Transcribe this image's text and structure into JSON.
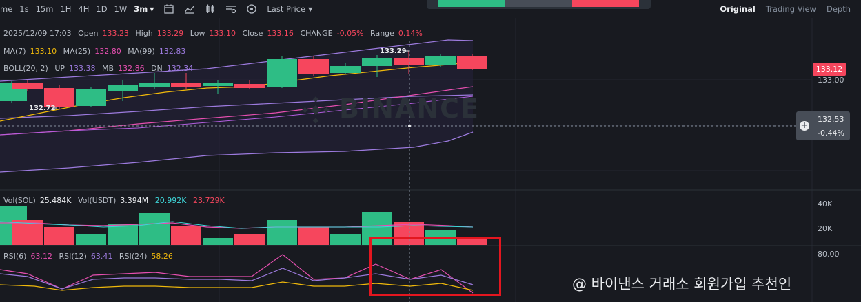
{
  "toolbar": {
    "intervals": [
      "me",
      "1s",
      "15m",
      "1H",
      "4H",
      "1D",
      "1W",
      "3m"
    ],
    "active_interval": "3m",
    "price_type": "Last Price",
    "views": [
      "Original",
      "Trading View",
      "Depth"
    ],
    "active_view": "Original"
  },
  "ohlc": {
    "datetime": "2025/12/09 17:03",
    "open_label": "Open",
    "open": "133.23",
    "high_label": "High",
    "high": "133.29",
    "low_label": "Low",
    "low": "133.10",
    "close_label": "Close",
    "close": "133.16",
    "change_label": "CHANGE",
    "change": "-0.05%",
    "range_label": "Range",
    "range": "0.14%"
  },
  "ma": {
    "ma7_label": "MA(7)",
    "ma7": "133.10",
    "ma25_label": "MA(25)",
    "ma25": "132.80",
    "ma99_label": "MA(99)",
    "ma99": "132.83"
  },
  "boll": {
    "label": "BOLL(20, 2)",
    "up_label": "UP",
    "up": "133.38",
    "mb_label": "MB",
    "mb": "132.86",
    "dn_label": "DN",
    "dn": "132.34"
  },
  "price_axis": {
    "current_price": "133.12",
    "tick_133": "133.00",
    "cross_price": "132.53",
    "cross_pct": "-0.44%",
    "high_marker": "133.29",
    "low_marker": "132.72"
  },
  "volume": {
    "sol_label": "Vol(SOL)",
    "sol": "25.484K",
    "usdt_label": "Vol(USDT)",
    "usdt": "3.394M",
    "ma1": "20.992K",
    "ma2": "23.729K",
    "tick_40k": "40K",
    "tick_20k": "20K"
  },
  "rsi": {
    "rsi6_label": "RSI(6)",
    "rsi6": "63.12",
    "rsi12_label": "RSI(12)",
    "rsi12": "63.41",
    "rsi24_label": "RSI(24)",
    "rsi24": "58.26",
    "tick_80": "80.00"
  },
  "watermark": "BINANCE",
  "promo_text": "@ 바이낸스 거래소 회원가입 추천인",
  "colors": {
    "up": "#2ebd85",
    "down": "#f6465d",
    "bg": "#181a20",
    "accent": "#f0b90b"
  }
}
